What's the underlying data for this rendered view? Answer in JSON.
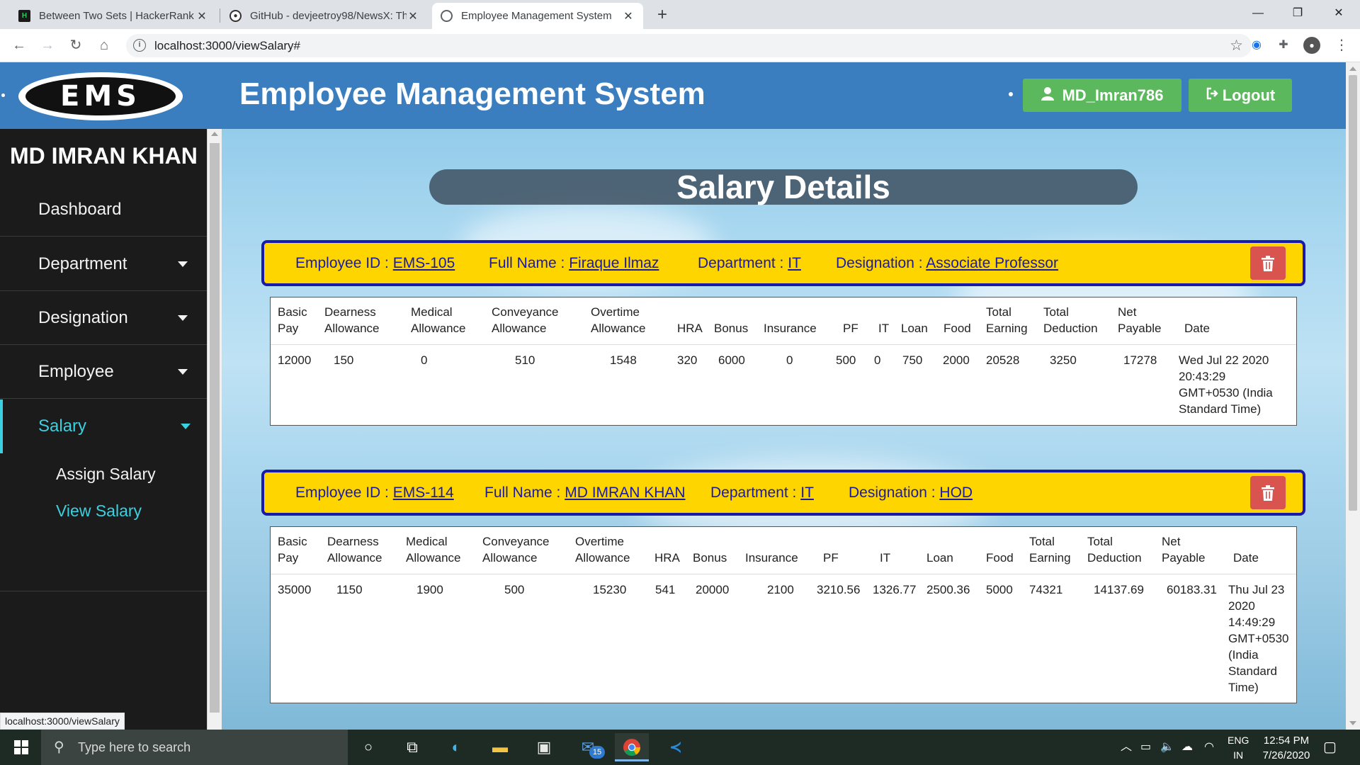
{
  "browser": {
    "tabs": [
      {
        "title": "Between Two Sets | HackerRank",
        "icon": "hackerrank-icon"
      },
      {
        "title": "GitHub - devjeetroy98/NewsX: Th",
        "icon": "github-icon"
      },
      {
        "title": "Employee Management System",
        "icon": "globe-icon"
      }
    ],
    "url": "localhost:3000/viewSalary#",
    "status_url": "localhost:3000/viewSalary"
  },
  "header": {
    "logo_text": "EMS",
    "title": "Employee Management System",
    "user_button": "MD_Imran786",
    "logout_button": "Logout"
  },
  "sidebar": {
    "user_name": "MD IMRAN KHAN",
    "items": [
      {
        "label": "Dashboard"
      },
      {
        "label": "Department"
      },
      {
        "label": "Designation"
      },
      {
        "label": "Employee"
      },
      {
        "label": "Salary"
      }
    ],
    "sub_items": [
      {
        "label": "Assign Salary"
      },
      {
        "label": "View Salary"
      }
    ]
  },
  "main": {
    "page_title": "Salary Details",
    "labels": {
      "employee_id": "Employee ID : ",
      "full_name": "Full Name : ",
      "department": "Department : ",
      "designation": "Designation : "
    },
    "records": [
      {
        "employee_id": "EMS-105",
        "full_name": "Firaque Ilmaz",
        "department": "IT",
        "designation": "Associate Professor",
        "headers": [
          "Basic Pay",
          "Dearness Allowance",
          "Medical Allowance",
          "Conveyance Allowance",
          "Overtime Allowance",
          "HRA",
          "Bonus",
          "Insurance",
          "PF",
          "IT",
          "Loan",
          "Food",
          "Total Earning",
          "Total Deduction",
          "Net Payable",
          "Date"
        ],
        "values": [
          "12000",
          "150",
          "0",
          "510",
          "1548",
          "320",
          "6000",
          "0",
          "500",
          "0",
          "750",
          "2000",
          "20528",
          "3250",
          "17278",
          "Wed Jul 22 2020 20:43:29 GMT+0530 (India Standard Time)"
        ]
      },
      {
        "employee_id": "EMS-114",
        "full_name": "MD IMRAN KHAN",
        "department": "IT",
        "designation": "HOD",
        "headers": [
          "Basic Pay",
          "Dearness Allowance",
          "Medical Allowance",
          "Conveyance Allowance",
          "Overtime Allowance",
          "HRA",
          "Bonus",
          "Insurance",
          "PF",
          "IT",
          "Loan",
          "Food",
          "Total Earning",
          "Total Deduction",
          "Net Payable",
          "Date"
        ],
        "values": [
          "35000",
          "1150",
          "1900",
          "500",
          "15230",
          "541",
          "20000",
          "2100",
          "3210.56",
          "1326.77",
          "2500.36",
          "5000",
          "74321",
          "14137.69",
          "60183.31",
          "Thu Jul 23 2020 14:49:29 GMT+0530 (India Standard Time)"
        ]
      }
    ]
  },
  "taskbar": {
    "search_placeholder": "Type here to search",
    "mail_badge": "15",
    "lang_line1": "ENG",
    "lang_line2": "IN",
    "time": "12:54 PM",
    "date": "7/26/2020"
  },
  "colors": {
    "header_blue": "#3a7ebf",
    "sidebar_bg": "#1b1b1b",
    "accent_cyan": "#3ad0e0",
    "button_green": "#5cb85c",
    "bar_yellow": "#ffd500",
    "bar_border": "#1a1aa8",
    "delete_red": "#d9534f"
  }
}
